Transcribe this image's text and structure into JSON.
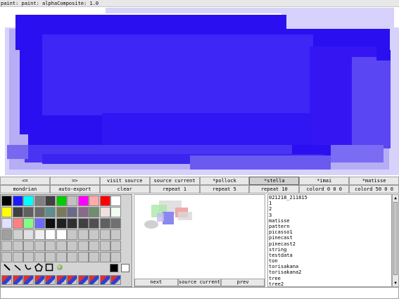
{
  "title": "paint: paint: alphaComposite: 1.0",
  "toolbar_row1": [
    "<=",
    "=>",
    "visit source",
    "source current",
    "*pollock",
    "*stella",
    "*imai",
    "*matisse"
  ],
  "toolbar_row1_pressed": "*stella",
  "toolbar_row2": [
    "mondrian",
    "auto-export",
    "clear",
    "repeat 1",
    "repeat 5",
    "repeat 10",
    "colord 0 0 0",
    "colord 50 0 0"
  ],
  "preview_buttons": [
    "next",
    "source current",
    "prev"
  ],
  "list_items": [
    "021218_211815",
    "1",
    "2",
    "3",
    "matisse",
    "pattern",
    "picasso1",
    "pinecast",
    "pinecast2",
    "string",
    "testdata",
    "ton",
    "torisakana",
    "torisakana2",
    "tree",
    "tree2"
  ],
  "palette_colors": [
    [
      "#000000",
      "#1a1aff",
      "#00ffff",
      "#808080",
      "#404040",
      "#00cc00",
      "#c0c0c0",
      "#ff00ff",
      "#ffaaaa",
      "#ff0000",
      "#ffffff"
    ],
    [
      "#ffff00",
      "#404040",
      "#606060",
      "#6a6a6a",
      "#5e8e8e",
      "#7a7a5a",
      "#6a6a8a",
      "#8a6a8a",
      "#6e8e6e",
      "#f0e0e0",
      "#f0fff0"
    ],
    [
      "#e0e0ff",
      "#ff8080",
      "#80ff80",
      "#6a6aff",
      "#101010",
      "#202020",
      "#303030",
      "#404040",
      "#505050",
      "#606060",
      "#707070"
    ],
    [
      "#a0a0a0",
      "#d0d0d0",
      "#e0e0e0",
      "#f0f0f0",
      "#ffffff",
      "#ffffff",
      "#c8c8c8",
      "#c8c8c8",
      "#c8c8c8",
      "#c8c8c8",
      "#c8c8c8"
    ]
  ],
  "tools": [
    "pencil-icon",
    "line-icon",
    "curve-icon",
    "shape-icon",
    "rect-icon",
    "image-icon"
  ],
  "colors": {
    "canvas_bg": "#ffffff",
    "blue_main": "#2a10f0",
    "blue_mid": "#3c28f5",
    "blue_light": "#b8b0f5",
    "blue_faint": "#d8d4fb",
    "panel_bg": "#e8e8e8"
  }
}
